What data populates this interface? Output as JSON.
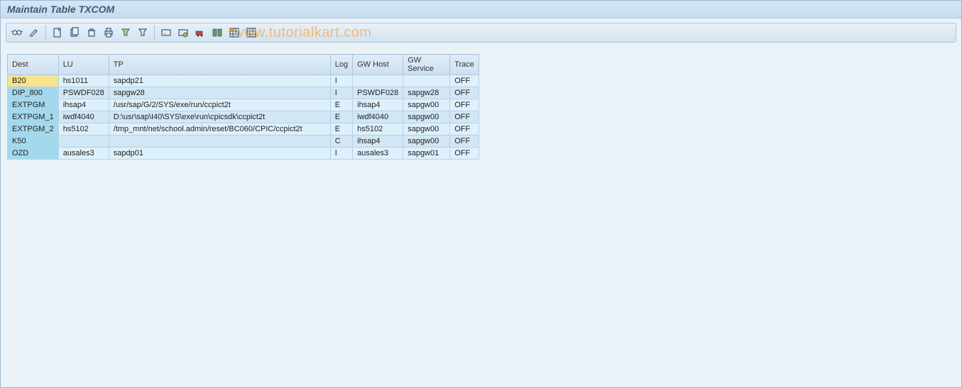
{
  "title": "Maintain Table TXCOM",
  "watermark": "www.tutorialkart.com",
  "toolbar_icons": [
    "glasses-icon",
    "pencil-icon",
    "sep",
    "new-icon",
    "copy-icon",
    "delete-icon",
    "sep",
    "print-icon",
    "filter-icon",
    "sep",
    "save-variant-icon",
    "get-variant-icon",
    "transport-icon",
    "compare-icon",
    "select-all-icon",
    "table-settings-icon"
  ],
  "columns": [
    {
      "key": "dest",
      "label": "Dest"
    },
    {
      "key": "lu",
      "label": "LU"
    },
    {
      "key": "tp",
      "label": "TP"
    },
    {
      "key": "log",
      "label": "Log"
    },
    {
      "key": "gwh",
      "label": "GW Host"
    },
    {
      "key": "gws",
      "label": "GW Service"
    },
    {
      "key": "trace",
      "label": "Trace"
    }
  ],
  "rows": [
    {
      "dest": "B20",
      "lu": "hs1011",
      "tp": "sapdp21",
      "log": "I",
      "gwh": "",
      "gws": "",
      "trace": "OFF",
      "selected": true
    },
    {
      "dest": "DIP_800",
      "lu": "PSWDF028",
      "tp": "sapgw28",
      "log": "I",
      "gwh": "PSWDF028",
      "gws": "sapgw28",
      "trace": "OFF"
    },
    {
      "dest": "EXTPGM",
      "lu": "ihsap4",
      "tp": "/usr/sap/G/2/SYS/exe/run/ccpict2t",
      "log": "E",
      "gwh": "ihsap4",
      "gws": "sapgw00",
      "trace": "OFF"
    },
    {
      "dest": "EXTPGM_1",
      "lu": "iwdf4040",
      "tp": "D:\\usr\\sap\\I40\\SYS\\exe\\run\\cpicsdk\\ccpict2t",
      "log": "E",
      "gwh": "iwdf4040",
      "gws": "sapgw00",
      "trace": "OFF"
    },
    {
      "dest": "EXTPGM_2",
      "lu": "hs5102",
      "tp": "/tmp_mnt/net/school.admin/reset/BC060/CPIC/ccpict2t",
      "log": "E",
      "gwh": "hs5102",
      "gws": "sapgw00",
      "trace": "OFF"
    },
    {
      "dest": "K50",
      "lu": "",
      "tp": "",
      "log": "C",
      "gwh": "ihsap4",
      "gws": "sapgw00",
      "trace": "OFF"
    },
    {
      "dest": "OZD",
      "lu": "ausales3",
      "tp": "sapdp01",
      "log": "I",
      "gwh": "ausales3",
      "gws": "sapgw01",
      "trace": "OFF"
    }
  ]
}
